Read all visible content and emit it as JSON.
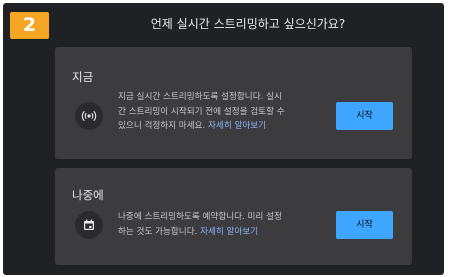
{
  "step_number": "2",
  "dialog": {
    "title": "언제 실시간 스트리밍하고 싶으신가요?"
  },
  "options": [
    {
      "heading": "지금",
      "icon": "broadcast-icon",
      "description_lines": [
        "지금 실시간 스트리밍하도록 설정합니다. 실시",
        "간 스트리밍이 시작되기 전에 설정을 검토할 수"
      ],
      "description_last": "있으니 걱정하지 마세요.",
      "learn_more": "자세히 알아보기",
      "button_label": "시작"
    },
    {
      "heading": "나중에",
      "icon": "calendar-icon",
      "description_lines": [
        "나중에 스트리밍하도록 예약합니다. 미리 설정"
      ],
      "description_last": "하는 것도 가능합니다.",
      "learn_more": "자세히 알아보기",
      "button_label": "시작"
    }
  ],
  "colors": {
    "step_badge": "#f5a623",
    "dialog_bg": "#202124",
    "card_bg": "#3c3c3f",
    "button_bg": "#3ea6ff",
    "link": "#8ab4f8"
  }
}
